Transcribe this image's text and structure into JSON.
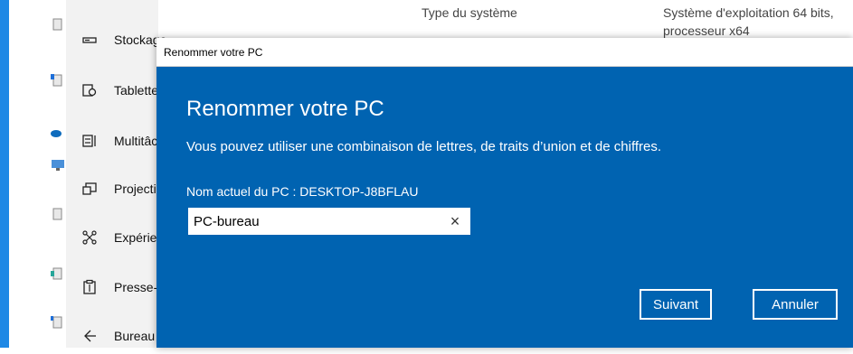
{
  "background": {
    "system_type_label": "Type du système",
    "system_type_value_line1": "Système d'exploitation 64 bits,",
    "system_type_value_line2": "processeur x64"
  },
  "sidebar": {
    "items": [
      {
        "label": "Stockage",
        "icon": "storage-icon"
      },
      {
        "label": "Tablette",
        "icon": "tablet-icon"
      },
      {
        "label": "Multitâche",
        "icon": "multitasking-icon"
      },
      {
        "label": "Projection",
        "icon": "projection-icon"
      },
      {
        "label": "Expériences",
        "icon": "shared-experiences-icon"
      },
      {
        "label": "Presse-papiers",
        "icon": "clipboard-icon"
      },
      {
        "label": "Bureau à distance",
        "icon": "remote-desktop-icon"
      }
    ]
  },
  "dialog": {
    "window_title": "Renommer votre PC",
    "heading": "Renommer votre PC",
    "description": "Vous pouvez utiliser une combinaison de lettres, de traits d’union et de chiffres.",
    "current_name_label": "Nom actuel du PC : DESKTOP-J8BFLAU",
    "input_value": "PC-bureau",
    "clear_glyph": "×",
    "next_label": "Suivant",
    "cancel_label": "Annuler"
  },
  "colors": {
    "dialog_bg": "#0063b1",
    "desktop_blue": "#1e88e5",
    "sidebar_bg": "#f2f2f2"
  }
}
